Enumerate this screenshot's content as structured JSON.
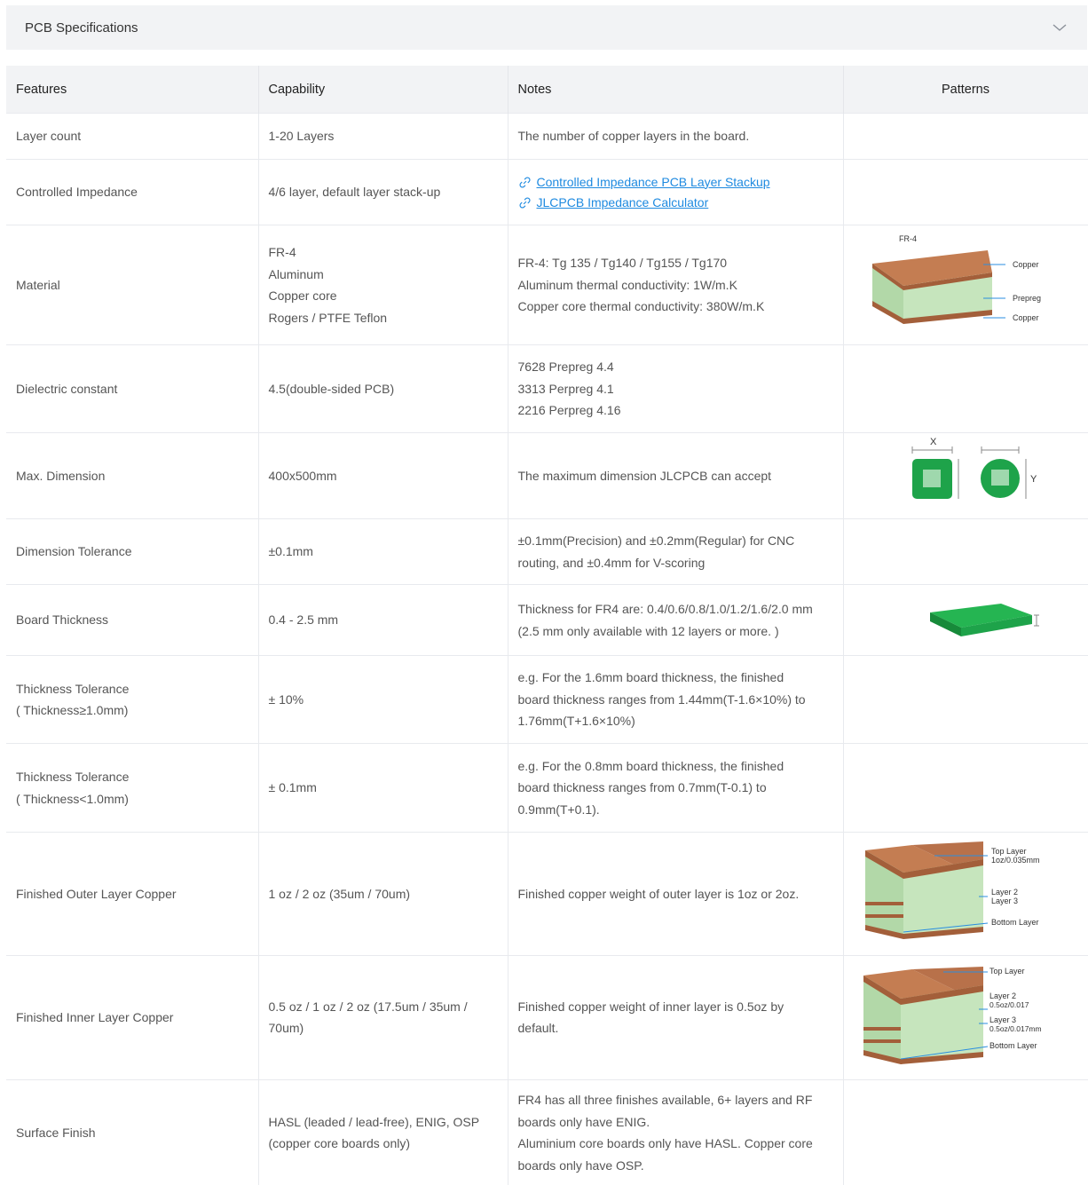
{
  "accordion": {
    "title": "PCB Specifications",
    "chevron_icon": "chevron-down-icon"
  },
  "table": {
    "headers": [
      "Features",
      "Capability",
      "Notes",
      "Patterns"
    ],
    "rows": [
      {
        "feature": "Layer count",
        "capability": [
          "1-20 Layers"
        ],
        "notes": [
          "The number of copper layers in the board."
        ]
      },
      {
        "feature": "Controlled Impedance",
        "capability": [
          "4/6 layer, default layer stack-up"
        ],
        "links": [
          "Controlled Impedance PCB Layer Stackup",
          "JLCPCB Impedance Calculator"
        ]
      },
      {
        "feature": "Material",
        "capability": [
          "FR-4",
          "Aluminum",
          "Copper core",
          "Rogers / PTFE Teflon"
        ],
        "notes": [
          "FR-4: Tg 135 / Tg140 / Tg155 / Tg170",
          "Aluminum thermal conductivity: 1W/m.K",
          "Copper core thermal conductivity: 380W/m.K"
        ],
        "pattern_labels": [
          "FR-4",
          "Copper",
          "Prepreg",
          "Copper"
        ]
      },
      {
        "feature": "Dielectric constant",
        "capability": [
          "4.5(double-sided PCB)"
        ],
        "notes": [
          "7628 Prepreg 4.4",
          "3313 Perpreg 4.1",
          "2216 Perpreg 4.16"
        ]
      },
      {
        "feature": "Max. Dimension",
        "capability": [
          "400x500mm"
        ],
        "notes": [
          "The maximum dimension JLCPCB can accept"
        ],
        "pattern_labels": [
          "X",
          "Y"
        ]
      },
      {
        "feature": "Dimension Tolerance",
        "capability": [
          "±0.1mm"
        ],
        "notes": [
          "±0.1mm(Precision) and ±0.2mm(Regular) for CNC",
          "routing, and ±0.4mm for V-scoring"
        ]
      },
      {
        "feature": "Board Thickness",
        "capability": [
          "0.4 - 2.5 mm"
        ],
        "notes": [
          "Thickness for FR4 are: 0.4/0.6/0.8/1.0/1.2/1.6/2.0 mm",
          "(2.5 mm only available with 12 layers or more. )"
        ]
      },
      {
        "feature": [
          "Thickness Tolerance",
          "( Thickness≥1.0mm)"
        ],
        "capability": [
          "± 10%"
        ],
        "notes": [
          "e.g. For the 1.6mm board thickness, the finished",
          "board thickness ranges from 1.44mm(T-1.6×10%) to",
          "1.76mm(T+1.6×10%)"
        ]
      },
      {
        "feature": [
          "Thickness Tolerance",
          "( Thickness<1.0mm)"
        ],
        "capability": [
          "± 0.1mm"
        ],
        "notes": [
          "e.g. For the 0.8mm board thickness, the finished",
          "board thickness ranges from 0.7mm(T-0.1) to",
          "0.9mm(T+0.1)."
        ]
      },
      {
        "feature": "Finished Outer Layer Copper",
        "capability": [
          "1 oz / 2 oz (35um / 70um)"
        ],
        "notes": [
          "Finished copper weight of outer layer is 1oz or 2oz."
        ],
        "pattern_labels": [
          "Top Layer",
          "1oz/0.035mm",
          "Layer 2",
          "Layer 3",
          "Bottom Layer"
        ]
      },
      {
        "feature": "Finished Inner Layer Copper",
        "capability": [
          "0.5 oz / 1 oz / 2 oz (17.5um / 35um /",
          "70um)"
        ],
        "notes": [
          "Finished copper weight of inner layer is 0.5oz by",
          "default."
        ],
        "pattern_labels": [
          "Top Layer",
          "Layer 2",
          "0.5oz/0.017",
          "Layer 3",
          "0.5oz/0.017mm",
          "Bottom Layer"
        ]
      },
      {
        "feature": "Surface Finish",
        "capability": [
          "HASL (leaded / lead-free), ENIG, OSP",
          "(copper core boards only)"
        ],
        "notes": [
          "FR4 has all three finishes available, 6+ layers and RF",
          "boards only have ENIG.",
          "Aluminium core boards only have HASL. Copper core",
          "boards only have OSP."
        ]
      }
    ]
  },
  "colors": {
    "header_bg": "#f2f3f5",
    "link": "#1e8ae0",
    "copper": "#b8714a",
    "prepreg": "#bfe0b5",
    "board_green": "#1ea34a",
    "leader_line": "#2a8ee0"
  }
}
